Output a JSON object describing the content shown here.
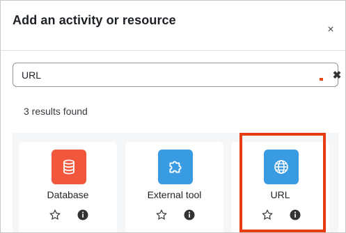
{
  "dialog": {
    "title": "Add an activity or resource",
    "close_glyph": "×"
  },
  "search": {
    "value": "URL",
    "clear_glyph": "✖"
  },
  "results": {
    "count_text": "3 results found"
  },
  "cards": [
    {
      "label": "Database",
      "icon": "database-icon",
      "color": "#f0573c"
    },
    {
      "label": "External tool",
      "icon": "puzzle-icon",
      "color": "#399be2"
    },
    {
      "label": "URL",
      "icon": "globe-icon",
      "color": "#399be2"
    }
  ],
  "highlight_color": "#e63c12"
}
